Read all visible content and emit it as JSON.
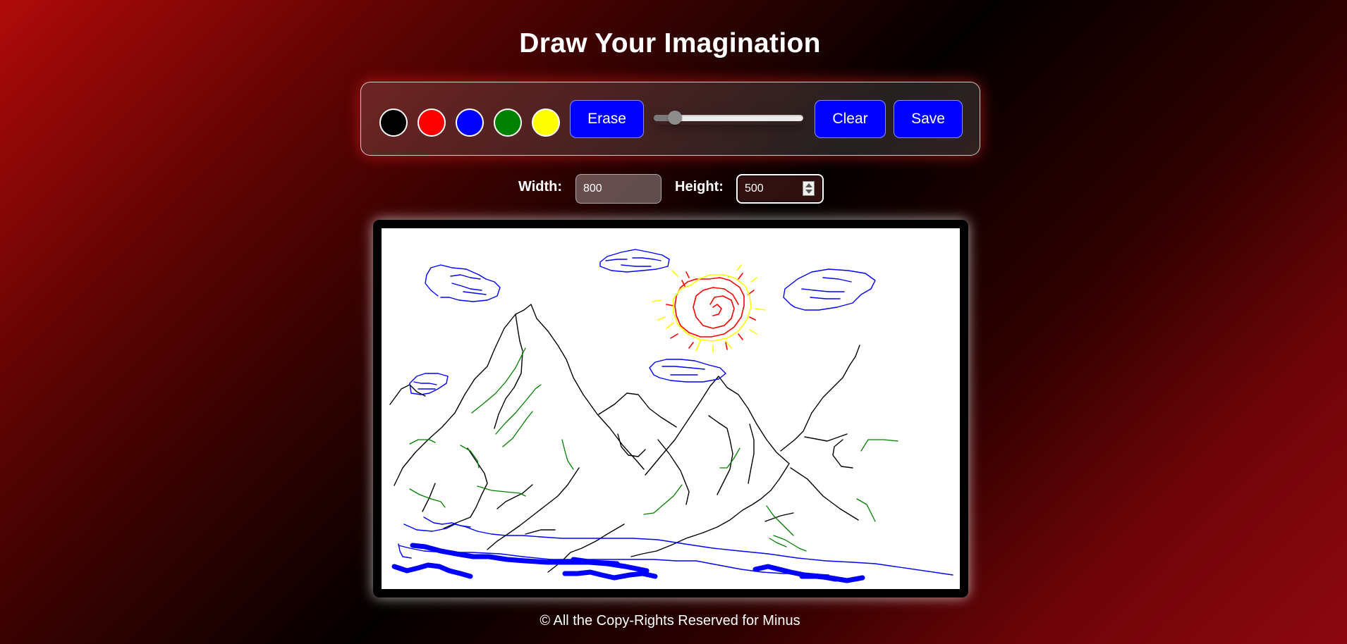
{
  "page": {
    "title": "Draw Your Imagination",
    "footer": "© All the Copy-Rights Reserved for Minus"
  },
  "toolbar": {
    "colors": [
      {
        "name": "black",
        "hex": "#000000"
      },
      {
        "name": "red",
        "hex": "#ff0000"
      },
      {
        "name": "blue",
        "hex": "#0000ff"
      },
      {
        "name": "green",
        "hex": "#008000"
      },
      {
        "name": "yellow",
        "hex": "#ffff00"
      }
    ],
    "erase_label": "Erase",
    "brush_size_fraction": 0.14,
    "clear_label": "Clear",
    "save_label": "Save"
  },
  "dimensions": {
    "width_label": "Width:",
    "width_value": "800",
    "height_label": "Height:",
    "height_value": "500"
  },
  "canvas": {
    "background": "#ffffff",
    "stroke_colors": {
      "mountains": "#000000",
      "grass": "#008000",
      "sky": "#0000ff",
      "sun_outer": "#ff0000",
      "sun_inner": "#ffff00"
    }
  }
}
